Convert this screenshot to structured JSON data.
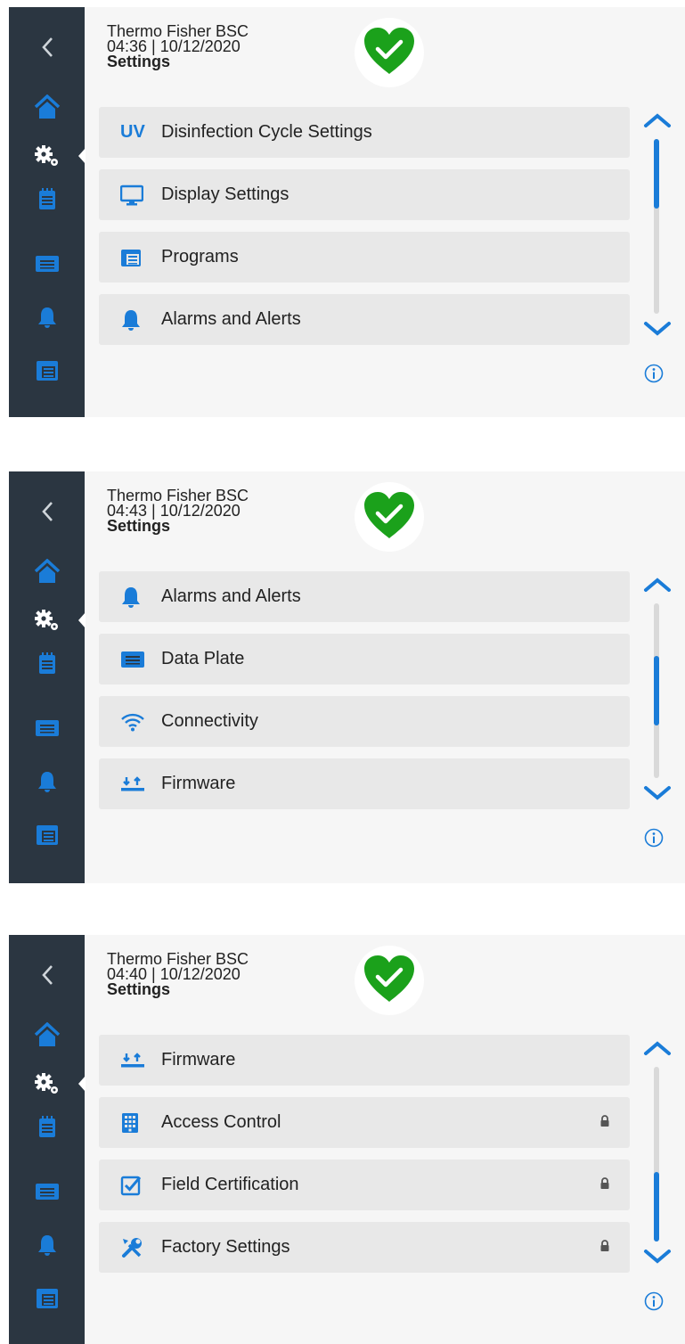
{
  "colors": {
    "accent": "#1a7cd8",
    "sidebar": "#2b3641",
    "ok_green": "#1ba11b",
    "row_bg": "#e8e8e8"
  },
  "screens": [
    {
      "header": {
        "title": "Thermo Fisher BSC",
        "datetime": "04:36 | 10/12/2020",
        "page": "Settings"
      },
      "status_icon": "heart-check-icon",
      "scroll_position": 0.0,
      "items": [
        {
          "icon": "uv-icon",
          "icon_text": "UV",
          "label": "Disinfection Cycle Settings",
          "locked": false
        },
        {
          "icon": "monitor-icon",
          "label": "Display Settings",
          "locked": false
        },
        {
          "icon": "programs-icon",
          "label": "Programs",
          "locked": false
        },
        {
          "icon": "bell-icon",
          "label": "Alarms and Alerts",
          "locked": false
        }
      ]
    },
    {
      "header": {
        "title": "Thermo Fisher BSC",
        "datetime": "04:43 | 10/12/2020",
        "page": "Settings"
      },
      "status_icon": "heart-check-icon",
      "scroll_position": 0.5,
      "items": [
        {
          "icon": "bell-icon",
          "label": "Alarms and Alerts",
          "locked": false
        },
        {
          "icon": "data-plate-icon",
          "label": "Data Plate",
          "locked": false
        },
        {
          "icon": "wifi-icon",
          "label": "Connectivity",
          "locked": false
        },
        {
          "icon": "firmware-icon",
          "label": "Firmware",
          "locked": false
        }
      ]
    },
    {
      "header": {
        "title": "Thermo Fisher BSC",
        "datetime": "04:40 | 10/12/2020",
        "page": "Settings"
      },
      "status_icon": "heart-check-icon",
      "scroll_position": 1.0,
      "items": [
        {
          "icon": "firmware-icon",
          "label": "Firmware",
          "locked": false
        },
        {
          "icon": "keypad-icon",
          "label": "Access Control",
          "locked": true
        },
        {
          "icon": "checkbox-icon",
          "label": "Field Certification",
          "locked": true
        },
        {
          "icon": "tools-icon",
          "label": "Factory Settings",
          "locked": true
        }
      ]
    }
  ],
  "sidebar_items": [
    "back-icon",
    "home-icon",
    "settings-icon",
    "programs-icon",
    "data-plate-icon",
    "bell-icon",
    "calendar-icon"
  ],
  "selected_sidebar": "settings-icon"
}
